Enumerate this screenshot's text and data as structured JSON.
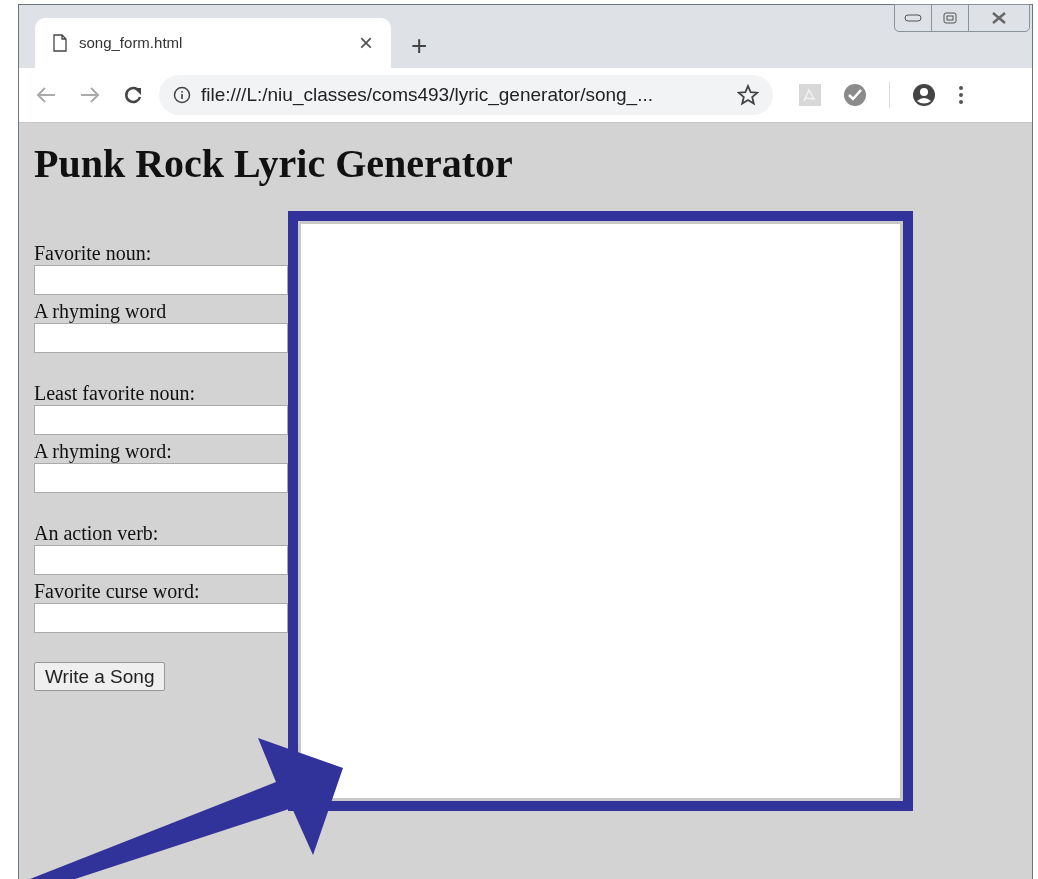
{
  "browser": {
    "tab": {
      "title": "song_form.html",
      "close": "×",
      "selected": true
    },
    "new_tab": "+",
    "address": "file:///L:/niu_classes/coms493/lyric_generator/song_..."
  },
  "page": {
    "heading": "Punk Rock Lyric Generator",
    "groups": [
      [
        {
          "label": "Favorite noun:"
        },
        {
          "label": "A rhyming word"
        }
      ],
      [
        {
          "label": "Least favorite noun:"
        },
        {
          "label": "A rhyming word:"
        }
      ],
      [
        {
          "label": "An action verb:"
        },
        {
          "label": "Favorite curse word:"
        }
      ]
    ],
    "button": "Write a Song"
  }
}
